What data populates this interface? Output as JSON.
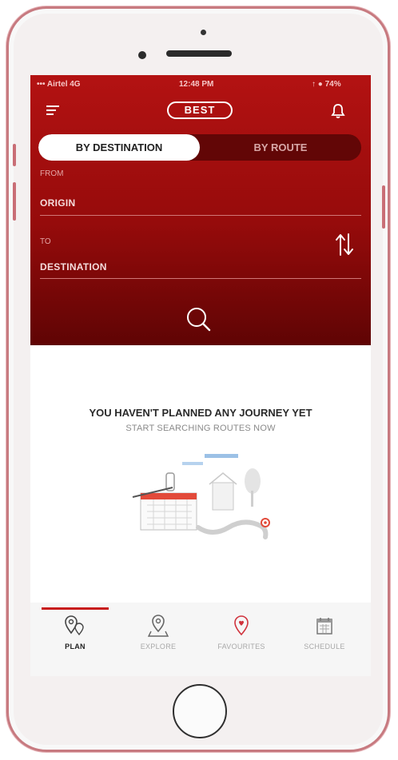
{
  "status_bar": {
    "carrier": "••• Airtel 4G",
    "time": "12:48 PM",
    "battery": "↑ ● 74%"
  },
  "header": {
    "mode_badge": "BEST"
  },
  "segmented": {
    "option_a": "BY DESTINATION",
    "option_b": "BY ROUTE",
    "selected": "BY DESTINATION"
  },
  "form": {
    "from_label": "FROM",
    "origin_value": "ORIGIN",
    "to_label": "TO",
    "destination_value": "DESTINATION"
  },
  "empty_state": {
    "title": "YOU HAVEN'T PLANNED ANY JOURNEY YET",
    "subtitle": "START SEARCHING ROUTES NOW"
  },
  "tabs": [
    {
      "label": "PLAN",
      "icon": "plan-icon",
      "active": true
    },
    {
      "label": "EXPLORE",
      "icon": "explore-icon",
      "active": false
    },
    {
      "label": "FAVOURITES",
      "icon": "favourites-icon",
      "active": false
    },
    {
      "label": "SCHEDULE",
      "icon": "schedule-icon",
      "active": false
    }
  ],
  "colors": {
    "accent": "#b31212",
    "dark_red": "#620606",
    "tab_active": "#c81c1c"
  }
}
